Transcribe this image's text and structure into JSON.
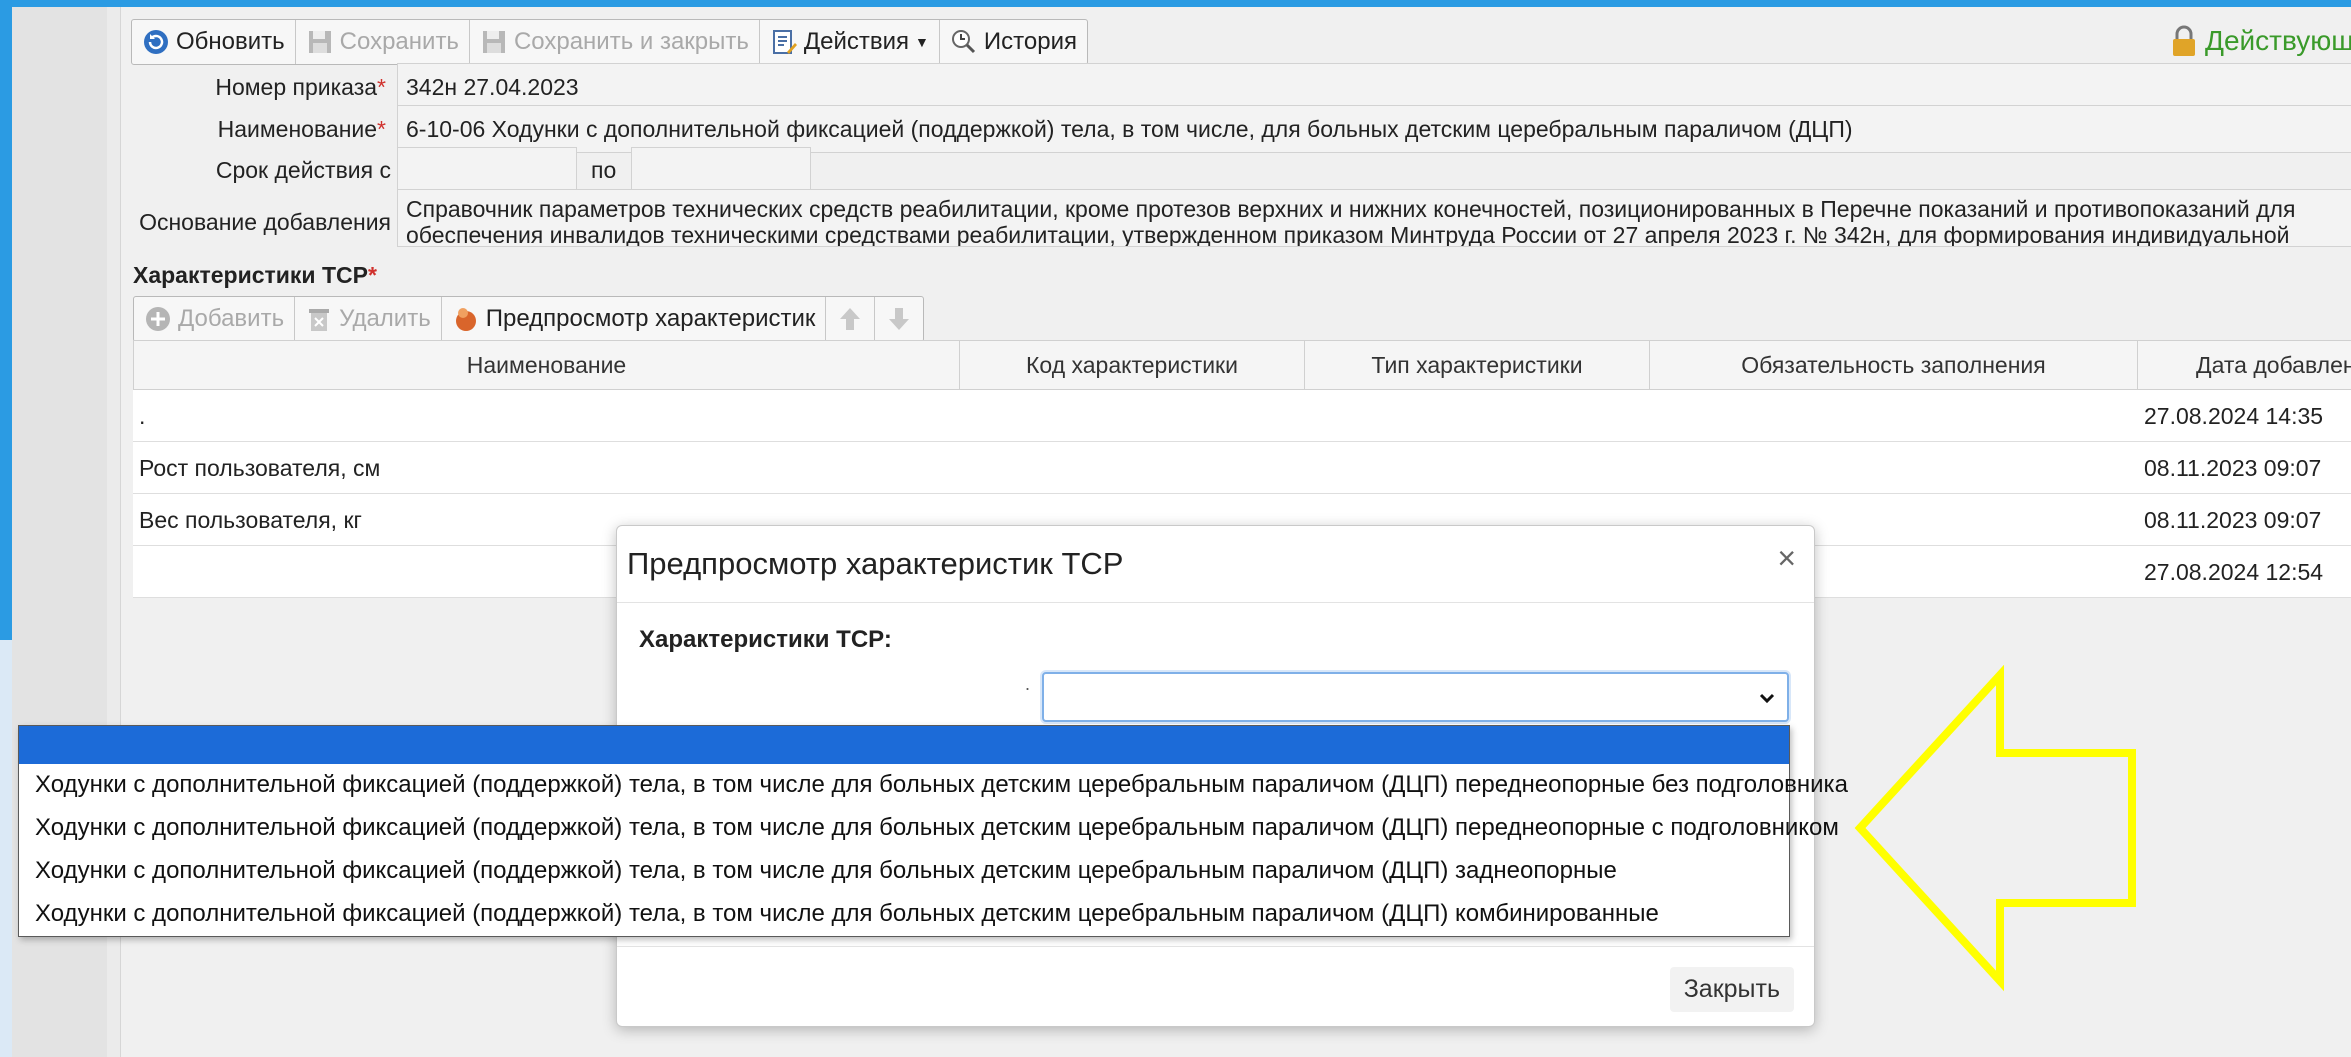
{
  "toolbar": {
    "refresh": "Обновить",
    "save": "Сохранить",
    "save_close": "Сохранить и закрыть",
    "actions": "Действия",
    "history": "История"
  },
  "status_text": "Действующа",
  "form": {
    "order_label": "Номер приказа",
    "order_value": "342н 27.04.2023",
    "name_label": "Наименование",
    "name_value": "6-10-06 Ходунки с дополнительной фиксацией (поддержкой) тела, в том числе, для больных детским церебральным параличом (ДЦП)",
    "period_label": "Срок действия с",
    "period_to": "по",
    "period_from_value": "",
    "period_to_value": "",
    "basis_label": "Основание добавления",
    "basis_value": "Справочник параметров технических средств реабилитации, кроме протезов верхних и нижних конечностей, позиционированных в Перечне показаний и противопоказаний для обеспечения инвалидов техническими средствами реабилитации, утвержденном приказом Минтруда России от 27 апреля 2023 г. № 342н, для формирования индивидуальной программы реабилитации и абилитации инвалида (ребенка-инвалида)",
    "required_mark": "*"
  },
  "characteristics": {
    "title": "Характеристики ТСР",
    "toolbar": {
      "add": "Добавить",
      "delete": "Удалить",
      "preview": "Предпросмотр характеристик"
    },
    "columns": [
      "Наименование",
      "Код характеристики",
      "Тип характеристики",
      "Обязательность заполнения",
      "Дата добавлен"
    ],
    "rows": [
      {
        "name": ".",
        "date": "27.08.2024 14:35"
      },
      {
        "name": "Рост пользователя, см",
        "date": "08.11.2023 09:07"
      },
      {
        "name": "Вес пользователя, кг",
        "date": "08.11.2023 09:07"
      },
      {
        "name": "",
        "date": "27.08.2024 12:54"
      }
    ]
  },
  "modal": {
    "title": "Предпросмотр характеристик ТСР",
    "close_icon": "×",
    "section": "Характеристики ТСР:",
    "dot": ".",
    "select_value": "",
    "close_button": "Закрыть"
  },
  "dropdown": {
    "options": [
      "",
      "Ходунки с дополнительной фиксацией (поддержкой) тела, в том числе для больных детским церебральным параличом (ДЦП) переднеопорные без подголовника",
      "Ходунки с дополнительной фиксацией (поддержкой) тела, в том числе для больных детским церебральным параличом (ДЦП) переднеопорные с подголовником",
      "Ходунки с дополнительной фиксацией (поддержкой) тела, в том числе для больных детским церебральным параличом (ДЦП) заднеопорные",
      "Ходунки с дополнительной фиксацией (поддержкой) тела, в том числе для больных детским церебральным параличом (ДЦП) комбинированные"
    ]
  },
  "colors": {
    "accent": "#1c6bd8",
    "status_green": "#3a9a2a",
    "arrow_yellow": "#ffff00",
    "background_blue": "#2b9be3"
  }
}
